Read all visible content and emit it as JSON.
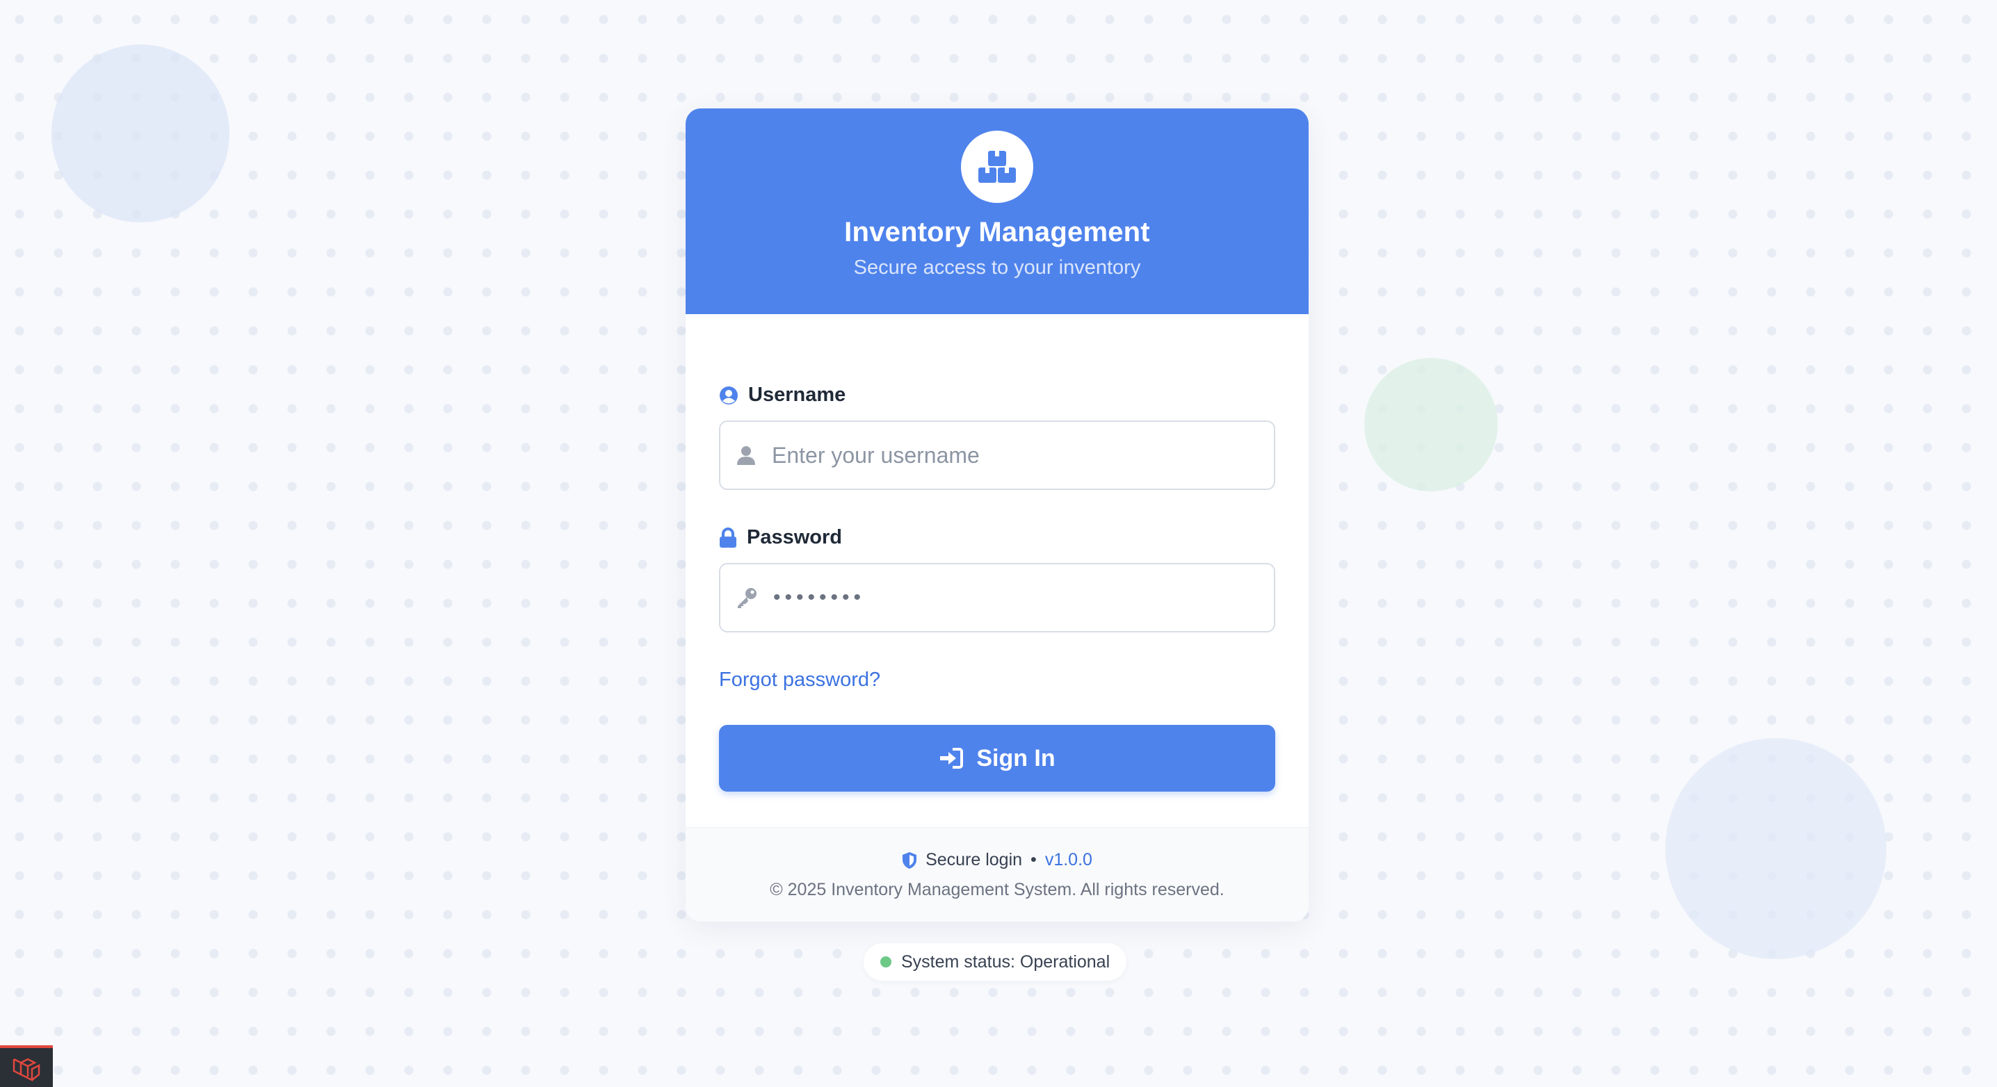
{
  "header": {
    "title": "Inventory Management",
    "subtitle": "Secure access to your inventory",
    "logo_icon": "boxes-icon"
  },
  "form": {
    "username": {
      "label": "Username",
      "label_icon": "user-circle-icon",
      "input_icon": "user-icon",
      "placeholder": "Enter your username",
      "value": ""
    },
    "password": {
      "label": "Password",
      "label_icon": "lock-icon",
      "input_icon": "key-icon",
      "value_masked": "••••••••"
    },
    "forgot_link": "Forgot password?",
    "signin_label": "Sign In",
    "signin_icon": "sign-in-icon"
  },
  "footer": {
    "secure_label": "Secure login",
    "separator": "•",
    "version": "v1.0.0",
    "copyright": "© 2025 Inventory Management System. All rights reserved."
  },
  "status": {
    "text": "System status: Operational",
    "color": "#6cc986"
  },
  "colors": {
    "primary": "#4f83ec",
    "link": "#3b72e0"
  }
}
